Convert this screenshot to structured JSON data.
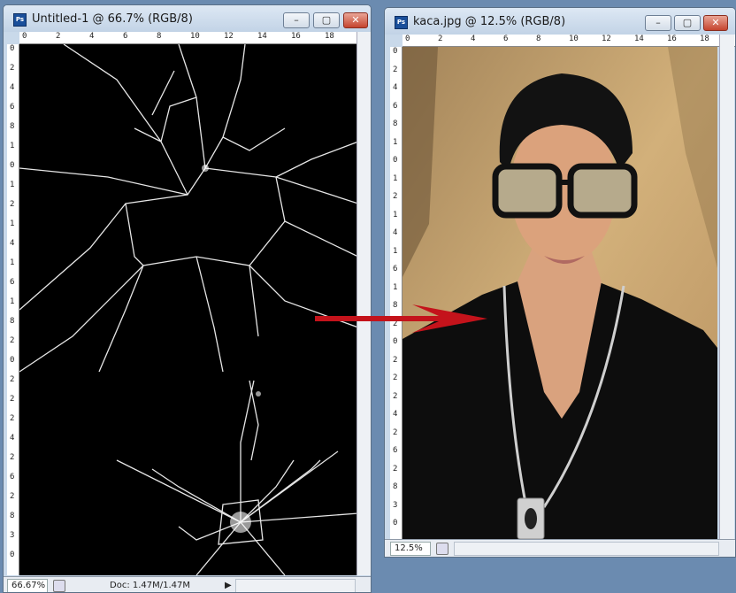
{
  "window_left": {
    "title": "Untitled-1 @ 66.7% (RGB/8)",
    "app_icon": "Ps",
    "ruler_h_labels": [
      "0",
      "2",
      "4",
      "6",
      "8",
      "10",
      "12",
      "14",
      "16",
      "18"
    ],
    "ruler_v_labels": [
      "0",
      "2",
      "4",
      "6",
      "8",
      "1",
      "0",
      "1",
      "2",
      "1",
      "4",
      "1",
      "6",
      "1",
      "8",
      "2",
      "0",
      "2",
      "2",
      "2",
      "4",
      "2",
      "6",
      "2",
      "8",
      "3",
      "0"
    ],
    "zoom": "66.67%",
    "doc_info": "Doc: 1.47M/1.47M"
  },
  "window_right": {
    "title": "kaca.jpg @ 12.5% (RGB/8)",
    "app_icon": "Ps",
    "ruler_h_labels": [
      "0",
      "2",
      "4",
      "6",
      "8",
      "10",
      "12",
      "14",
      "16",
      "18"
    ],
    "ruler_v_labels": [
      "0",
      "2",
      "4",
      "6",
      "8",
      "1",
      "0",
      "1",
      "2",
      "1",
      "4",
      "1",
      "6",
      "1",
      "8",
      "2",
      "0",
      "2",
      "2",
      "2",
      "4",
      "2",
      "6",
      "2",
      "8",
      "3",
      "0"
    ],
    "zoom": "12.5%"
  },
  "buttons": {
    "minimize": "–",
    "maximize": "▢",
    "close": "✕"
  },
  "icons": [
    "photoshop-icon",
    "minimize-icon",
    "maximize-icon",
    "close-icon",
    "arrow-right-icon"
  ],
  "colors": {
    "arrow": "#c4131b",
    "canvas_bg": "#000000",
    "photo_bg": "#c8a46a"
  }
}
